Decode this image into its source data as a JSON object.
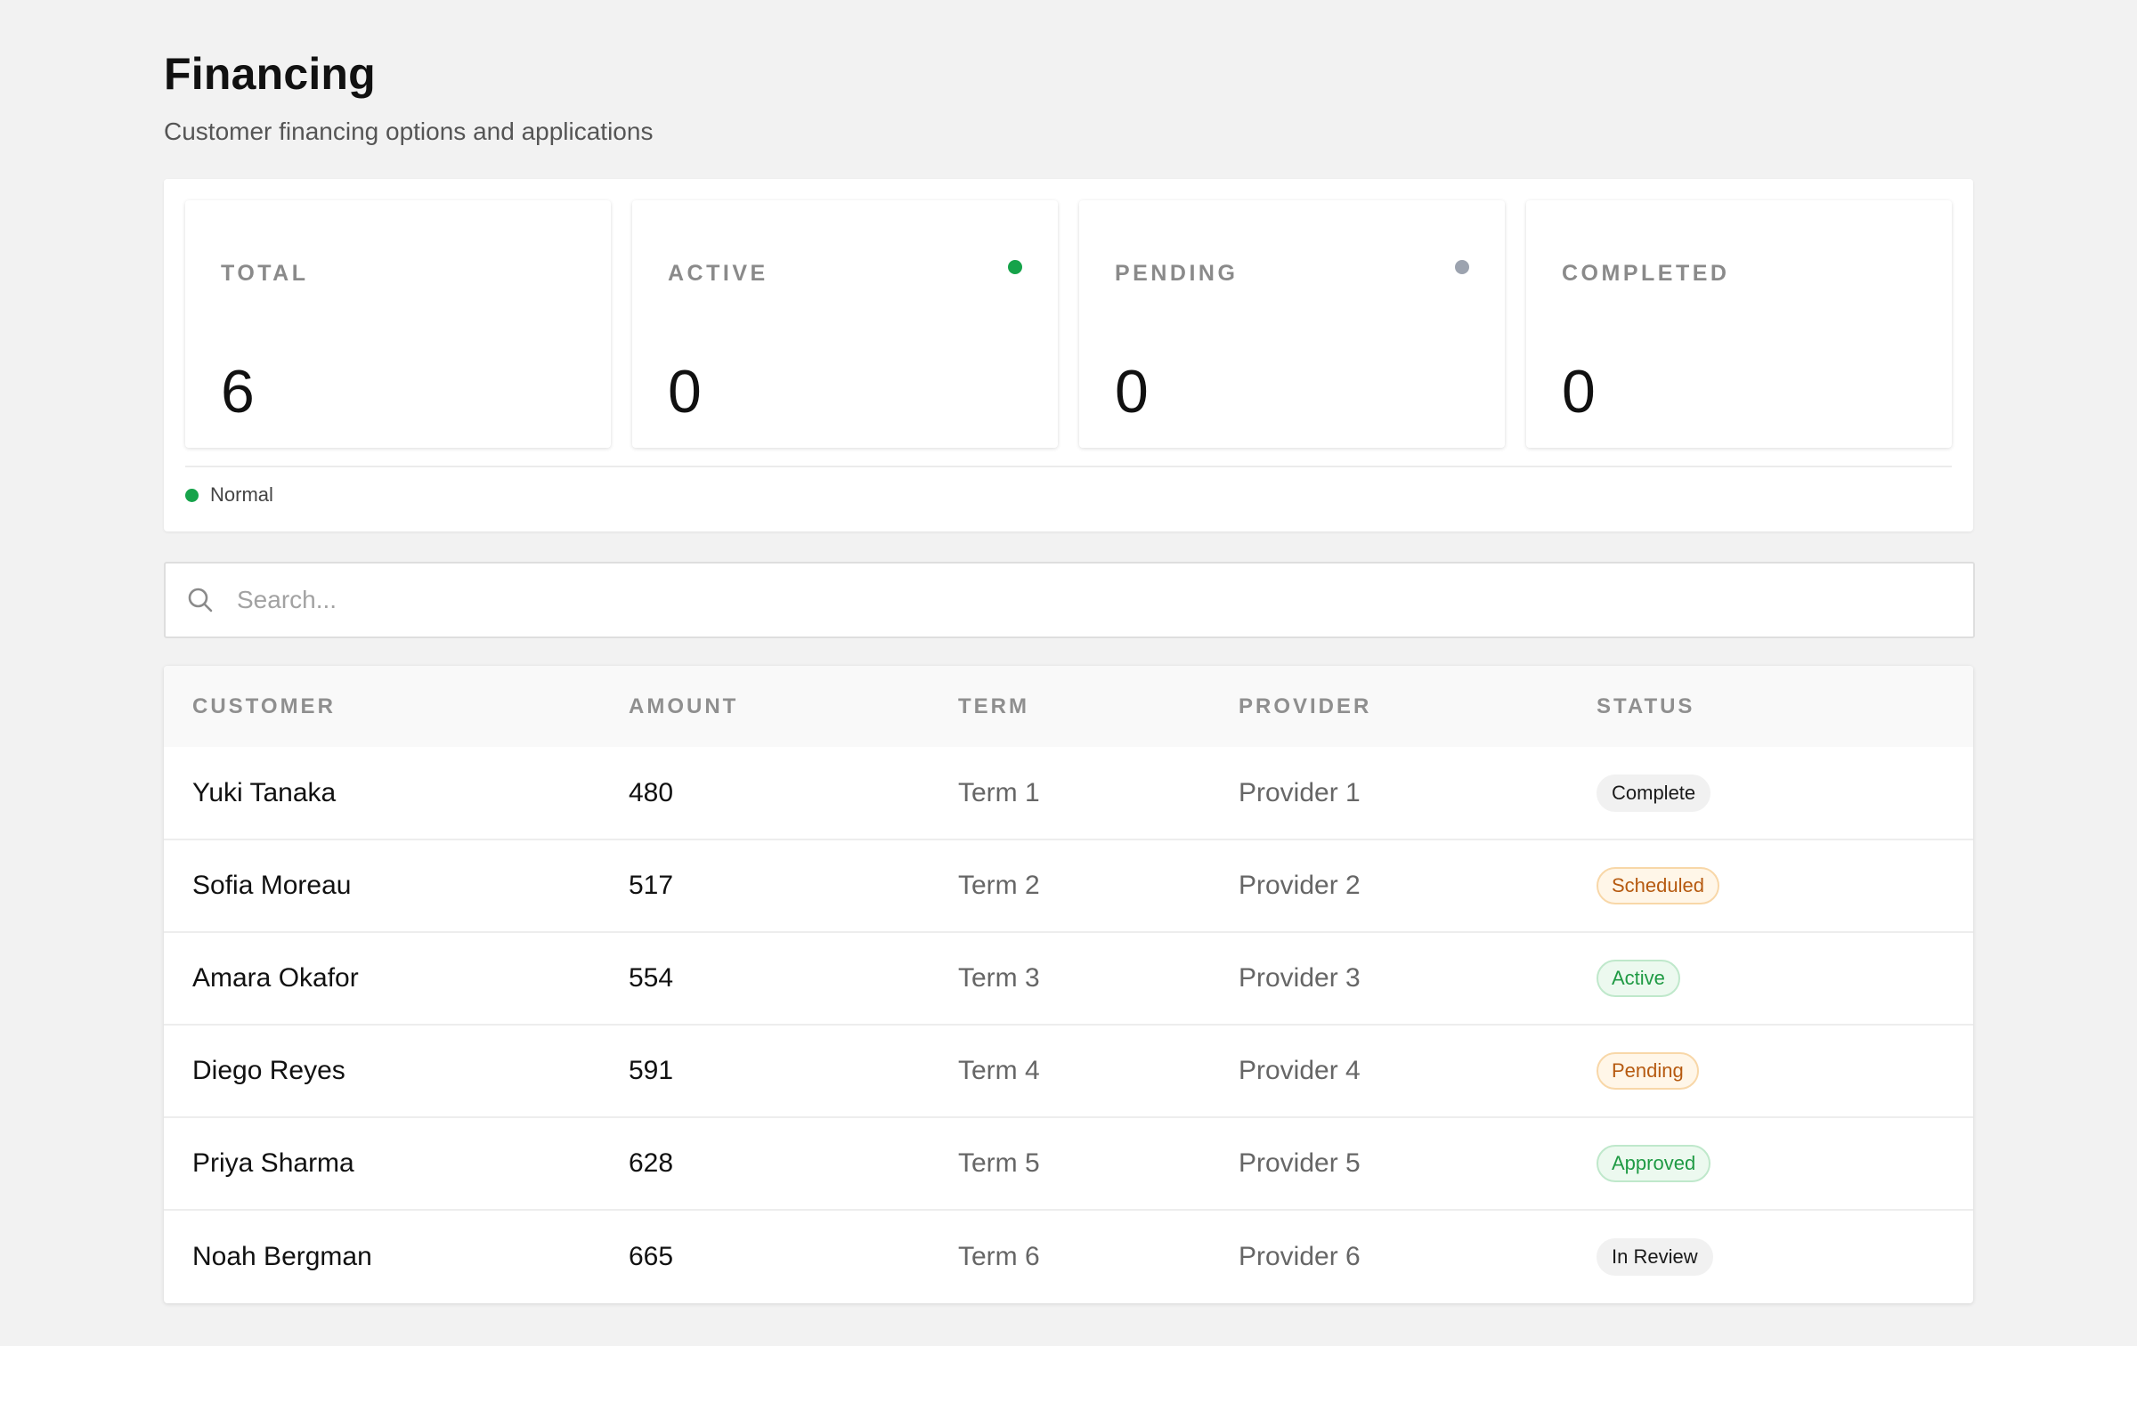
{
  "header": {
    "title": "Financing",
    "subtitle": "Customer financing options and applications"
  },
  "stats": [
    {
      "label": "TOTAL",
      "value": "6",
      "dot": null
    },
    {
      "label": "ACTIVE",
      "value": "0",
      "dot": "#16a34a"
    },
    {
      "label": "PENDING",
      "value": "0",
      "dot": "#9ca3af"
    },
    {
      "label": "COMPLETED",
      "value": "0",
      "dot": null
    }
  ],
  "legend": {
    "label": "Normal",
    "color": "#16a34a"
  },
  "search": {
    "placeholder": "Search..."
  },
  "table": {
    "columns": [
      "CUSTOMER",
      "AMOUNT",
      "TERM",
      "PROVIDER",
      "STATUS"
    ],
    "rows": [
      {
        "customer": "Yuki Tanaka",
        "amount": "480",
        "term": "Term 1",
        "provider": "Provider 1",
        "status": "Complete",
        "tone": "neutral"
      },
      {
        "customer": "Sofia Moreau",
        "amount": "517",
        "term": "Term 2",
        "provider": "Provider 2",
        "status": "Scheduled",
        "tone": "orange"
      },
      {
        "customer": "Amara Okafor",
        "amount": "554",
        "term": "Term 3",
        "provider": "Provider 3",
        "status": "Active",
        "tone": "green"
      },
      {
        "customer": "Diego Reyes",
        "amount": "591",
        "term": "Term 4",
        "provider": "Provider 4",
        "status": "Pending",
        "tone": "orange"
      },
      {
        "customer": "Priya Sharma",
        "amount": "628",
        "term": "Term 5",
        "provider": "Provider 5",
        "status": "Approved",
        "tone": "green"
      },
      {
        "customer": "Noah Bergman",
        "amount": "665",
        "term": "Term 6",
        "provider": "Provider 6",
        "status": "In Review",
        "tone": "neutral"
      }
    ]
  },
  "icons": {
    "search": "search-icon"
  }
}
